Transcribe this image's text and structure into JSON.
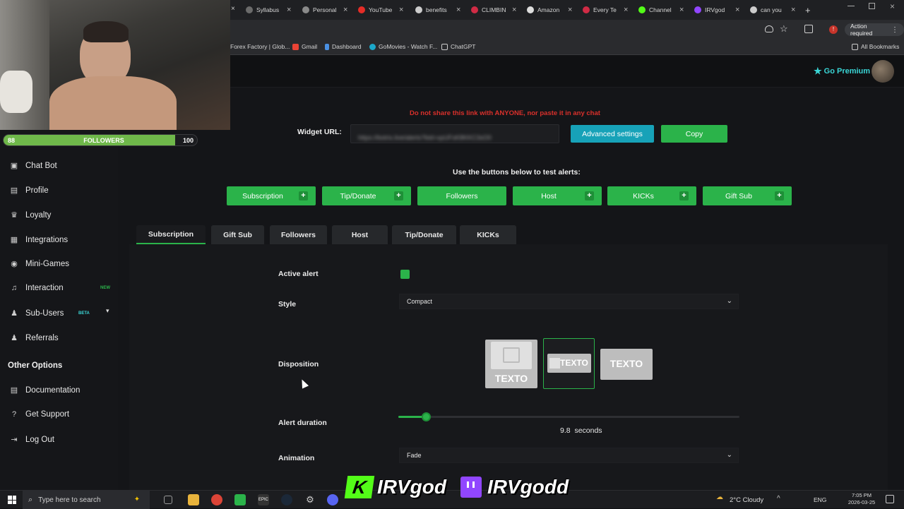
{
  "browser": {
    "tabs": [
      {
        "label": "Syllabus",
        "color": "#6b6b6b"
      },
      {
        "label": "Personal",
        "color": "#8a8a8a"
      },
      {
        "label": "YouTube",
        "color": "#e52d27"
      },
      {
        "label": "benefits",
        "color": "#cccccc"
      },
      {
        "label": "CLIMBIN",
        "color": "#d02b45"
      },
      {
        "label": "Amazon",
        "color": "#dddddd"
      },
      {
        "label": "Every Te",
        "color": "#d02b45"
      },
      {
        "label": "Channel",
        "color": "#53fc18"
      },
      {
        "label": "IRVgod",
        "color": "#9146ff"
      },
      {
        "label": "can you",
        "color": "#cccccc"
      }
    ],
    "new_tab": "+",
    "action_required": "Action required",
    "bookmarks": [
      "Forex Factory | Glob...",
      "Gmail",
      "Dashboard",
      "GoMovies - Watch F...",
      "ChatGPT"
    ],
    "all_bookmarks": "All Bookmarks"
  },
  "overlay": {
    "followers_left": "88",
    "followers_label": "FOLLOWERS",
    "followers_right": "100",
    "followers_progress": 0.88,
    "kick_name": "IRVgod",
    "twitch_name": "IRVgodd"
  },
  "header": {
    "go_premium": "Go Premium"
  },
  "sidebar": {
    "items": [
      {
        "label": "Chat Bot",
        "icon": "robot-icon"
      },
      {
        "label": "Profile",
        "icon": "profile-icon"
      },
      {
        "label": "Loyalty",
        "icon": "trophy-icon"
      },
      {
        "label": "Integrations",
        "icon": "integrations-icon"
      },
      {
        "label": "Mini-Games",
        "icon": "gamepad-icon"
      },
      {
        "label": "Interaction",
        "icon": "music-icon",
        "badge": "NEW"
      },
      {
        "label": "Sub-Users",
        "icon": "users-icon",
        "badge": "BETA"
      },
      {
        "label": "Referrals",
        "icon": "referrals-icon"
      }
    ],
    "section_title": "Other Options",
    "other": [
      {
        "label": "Documentation",
        "icon": "document-icon"
      },
      {
        "label": "Get Support",
        "icon": "question-icon"
      },
      {
        "label": "Log Out",
        "icon": "logout-icon"
      }
    ]
  },
  "main": {
    "warning": "Do not share this link with ANYONE, nor paste it in any chat",
    "widget_url_label": "Widget URL:",
    "widget_url_value": "https://botrix.live/alerts?bid=xpUFsK8KKC3sO0",
    "advanced_settings": "Advanced settings",
    "copy": "Copy",
    "test_hint": "Use the buttons below to test alerts:",
    "test_buttons": [
      "Subscription",
      "Tip/Donate",
      "Followers",
      "Host",
      "KICKs",
      "Gift Sub"
    ],
    "tabs": [
      "Subscription",
      "Gift Sub",
      "Followers",
      "Host",
      "Tip/Donate",
      "KICKs"
    ],
    "active_tab": "Subscription",
    "active_alert_label": "Active alert",
    "style_label": "Style",
    "style_value": "Compact",
    "disposition_label": "Disposition",
    "disposition_text": "TEXTO",
    "alert_duration_label": "Alert duration",
    "alert_duration_value": "9.8",
    "alert_duration_unit": "seconds",
    "alert_duration_level": 0.08,
    "animation_label": "Animation",
    "animation_value": "Fade"
  },
  "taskbar": {
    "search_placeholder": "Type here to search",
    "weather": "2°C  Cloudy",
    "language": "ENG",
    "time": "7:05 PM",
    "date": "2026-03-25"
  },
  "colors": {
    "accent_green": "#2bb34a",
    "teal": "#17a2b8",
    "warning_red": "#d9302b"
  }
}
